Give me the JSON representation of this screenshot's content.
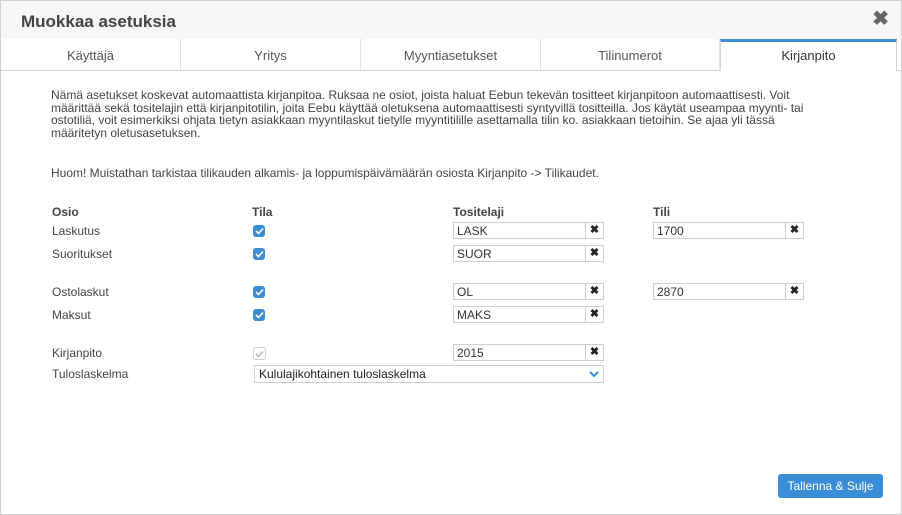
{
  "dialog": {
    "title": "Muokkaa asetuksia"
  },
  "tabs": [
    {
      "label": "Käyttäjä"
    },
    {
      "label": "Yritys"
    },
    {
      "label": "Myyntiasetukset"
    },
    {
      "label": "Tilinumerot"
    },
    {
      "label": "Kirjanpito",
      "active": true
    }
  ],
  "intro": {
    "lines": [
      "Nämä asetukset koskevat automaattista kirjanpitoa. Ruksaa ne osiot, joista haluat Eebun tekevän tositteet kirjanpitoon automaattisesti. Voit",
      "määrittää sekä tositelajin että kirjanpitotilin, joita Eebu käyttää oletuksena automaattisesti syntyvillä tositteilla. Jos käytät useampaa myynti- tai",
      "ostotiliä, voit esimerkiksi ohjata tietyn asiakkaan myyntilaskut tietylle myyntitilille asettamalla tilin ko. asiakkaan tietoihin. Se ajaa yli tässä",
      "määritetyn oletusasetuksen."
    ],
    "note": "Huom! Muistathan tarkistaa tilikauden alkamis- ja loppumispäivämäärän osiosta Kirjanpito -> Tilikaudet."
  },
  "table": {
    "headers": {
      "osio": "Osio",
      "tila": "Tila",
      "tositelaji": "Tositelaji",
      "tili": "Tili"
    },
    "rows": [
      {
        "label": "Laskutus",
        "checked": true,
        "tositelaji": "LASK",
        "tili": "1700"
      },
      {
        "label": "Suoritukset",
        "checked": true,
        "tositelaji": "SUOR",
        "tili": null
      },
      {
        "label": "Ostolaskut",
        "checked": true,
        "tositelaji": "OL",
        "tili": "2870"
      },
      {
        "label": "Maksut",
        "checked": true,
        "tositelaji": "MAKS",
        "tili": null
      },
      {
        "label": "Kirjanpito",
        "checked": true,
        "disabled": true,
        "tositelaji": "2015",
        "tili": null
      }
    ],
    "tuloslaskelma": {
      "label": "Tuloslaskelma",
      "selected": "Kululajikohtainen tuloslaskelma"
    }
  },
  "buttons": {
    "save": "Tallenna & Sulje",
    "clear_symbol": "✖",
    "close_symbol": "✖"
  },
  "colors": {
    "accent": "#3a8ed8",
    "header_bg": "#f7f7f7"
  }
}
